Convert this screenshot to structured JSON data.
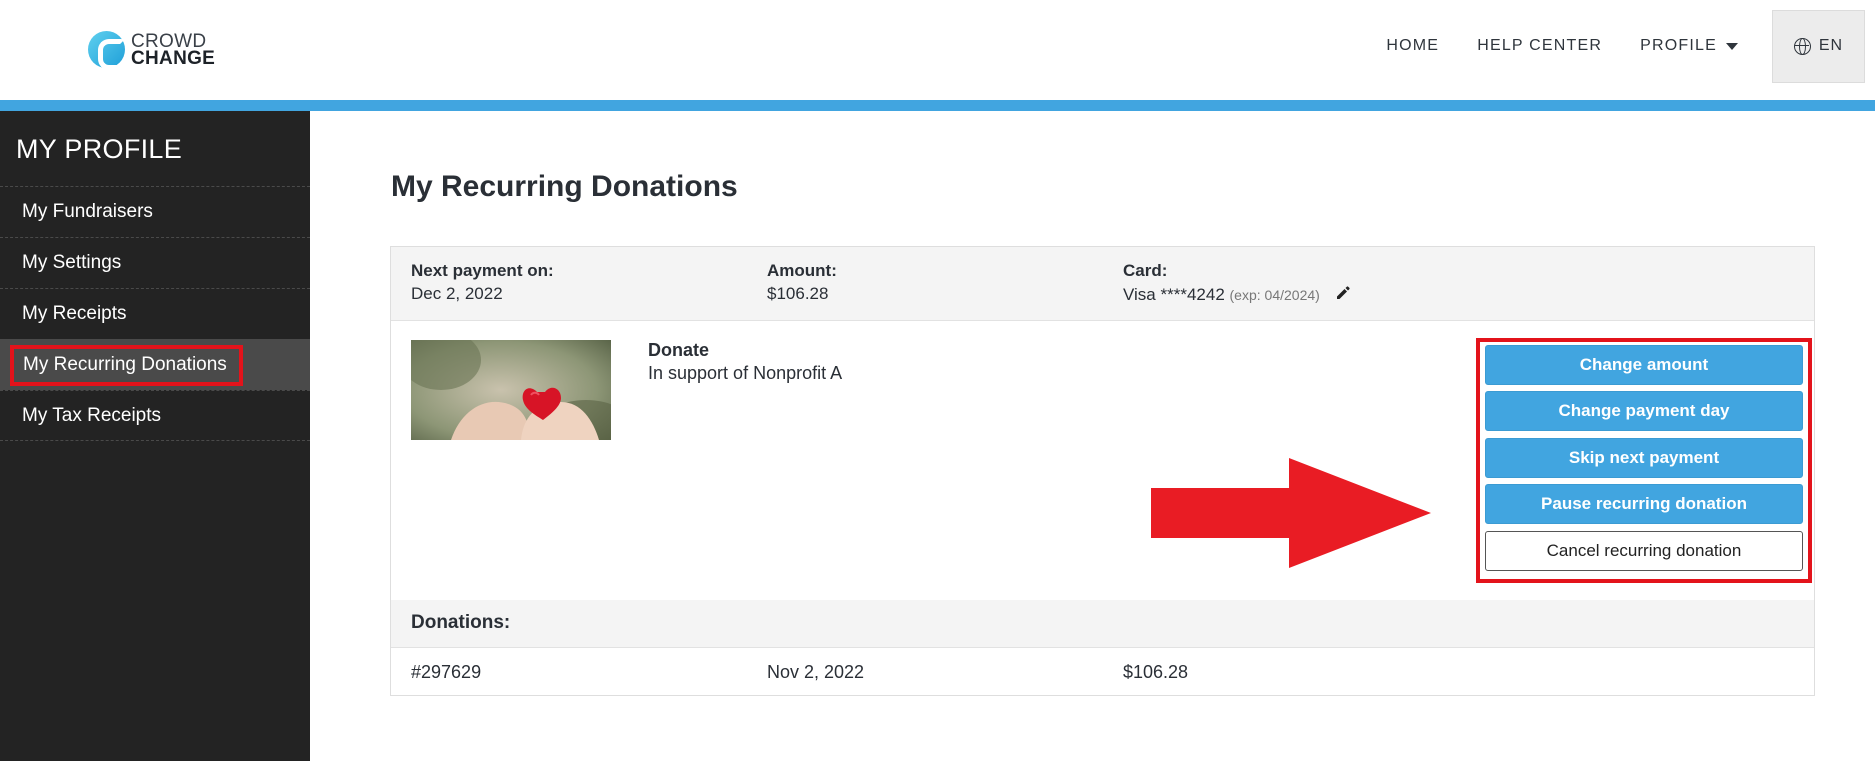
{
  "header": {
    "logo_line1": "CROWD",
    "logo_line2": "CHANGE",
    "nav": {
      "home": "HOME",
      "help_center": "HELP CENTER",
      "profile": "PROFILE",
      "language": "EN"
    }
  },
  "sidebar": {
    "title": "MY PROFILE",
    "items": [
      {
        "label": "My Fundraisers"
      },
      {
        "label": "My Settings"
      },
      {
        "label": "My Receipts"
      },
      {
        "label": "My Recurring Donations"
      },
      {
        "label": "My Tax Receipts"
      }
    ],
    "active_index": 3
  },
  "main": {
    "title": "My Recurring Donations",
    "summary": {
      "next_payment_label": "Next payment on:",
      "next_payment_value": "Dec 2, 2022",
      "amount_label": "Amount:",
      "amount_value": "$106.28",
      "card_label": "Card:",
      "card_value": "Visa ****4242",
      "card_exp": "(exp: 04/2024)"
    },
    "donation": {
      "title": "Donate",
      "subtitle": "In support of Nonprofit A"
    },
    "actions": {
      "change_amount": "Change amount",
      "change_payment_day": "Change payment day",
      "skip_next_payment": "Skip next payment",
      "pause": "Pause recurring donation",
      "cancel": "Cancel recurring donation"
    },
    "donations_label": "Donations:",
    "donations": [
      {
        "id": "#297629",
        "date": "Nov 2, 2022",
        "amount": "$106.28"
      }
    ]
  },
  "colors": {
    "accent_blue": "#41a5e0",
    "highlight_red": "#e3131b",
    "sidebar_bg": "#232323"
  }
}
